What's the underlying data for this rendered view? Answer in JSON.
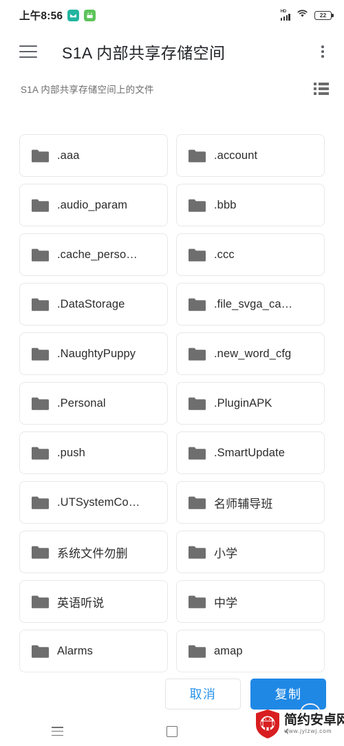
{
  "status_bar": {
    "time": "上午8:56",
    "app_icons": [
      "mail-app-icon",
      "calendar-app-icon"
    ],
    "signal_label": "HD",
    "wifi": "wifi-icon",
    "battery_level": "22"
  },
  "app_bar": {
    "menu_icon": "hamburger-menu-icon",
    "title": "S1A 内部共享存储空间",
    "overflow_icon": "overflow-menu-icon"
  },
  "subtitle_row": {
    "text": "S1A 内部共享存储空间上的文件",
    "view_toggle_icon": "list-view-icon"
  },
  "files": [
    {
      "name": ".aaa",
      "cjk": false
    },
    {
      "name": ".account",
      "cjk": false
    },
    {
      "name": ".audio_param",
      "cjk": false
    },
    {
      "name": ".bbb",
      "cjk": false
    },
    {
      "name": ".cache_perso…",
      "cjk": false
    },
    {
      "name": ".ccc",
      "cjk": false
    },
    {
      "name": ".DataStorage",
      "cjk": false
    },
    {
      "name": ".file_svga_ca…",
      "cjk": false
    },
    {
      "name": ".NaughtyPuppy",
      "cjk": false
    },
    {
      "name": ".new_word_cfg",
      "cjk": false
    },
    {
      "name": ".Personal",
      "cjk": false
    },
    {
      "name": ".PluginAPK",
      "cjk": false
    },
    {
      "name": ".push",
      "cjk": false
    },
    {
      "name": ".SmartUpdate",
      "cjk": false
    },
    {
      "name": ".UTSystemCo…",
      "cjk": false
    },
    {
      "name": "名师辅导班",
      "cjk": true
    },
    {
      "name": "系统文件勿删",
      "cjk": true
    },
    {
      "name": "小学",
      "cjk": true
    },
    {
      "name": "英语听说",
      "cjk": true
    },
    {
      "name": "中学",
      "cjk": true
    },
    {
      "name": "Alarms",
      "cjk": false
    },
    {
      "name": "amap",
      "cjk": false
    }
  ],
  "action_bar": {
    "cancel_label": "取消",
    "confirm_label": "复制"
  },
  "nav_bar": {
    "recents_icon": "recents-icon",
    "home_icon": "home-icon",
    "back_icon": "back-icon"
  },
  "watermark": {
    "site_name": "简约安卓网",
    "url": "www.jylzwj.com"
  },
  "colors": {
    "accent_blue": "#1f88e5",
    "cancel_text": "#2b93e8",
    "folder_gray": "#6e6e6e",
    "card_border": "#e8e8e8",
    "watermark_red": "#d81e20"
  }
}
